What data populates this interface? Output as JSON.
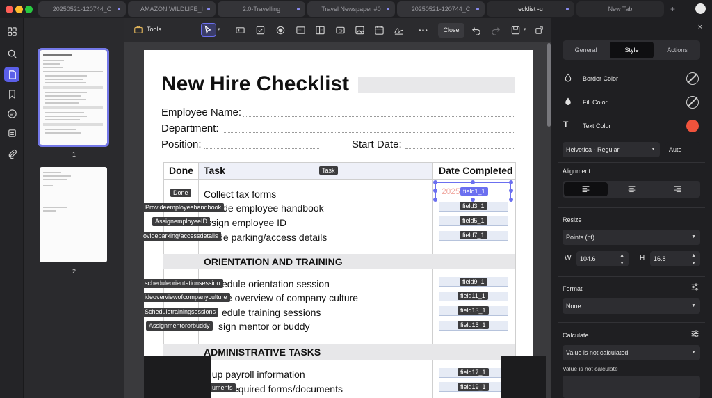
{
  "tabs": [
    {
      "label": "20250521-120744_C"
    },
    {
      "label": "AMAZON WILDLIFE_I"
    },
    {
      "label": "2.0-Travelling"
    },
    {
      "label": "Travel Newspaper #0"
    },
    {
      "label": "20250521-120744_C"
    },
    {
      "label": "ecklist -u"
    },
    {
      "label": "New Tab"
    }
  ],
  "toolbar": {
    "tools_label": "Tools",
    "close_label": "Close"
  },
  "thumbnails": [
    {
      "page": "1"
    },
    {
      "page": "2"
    }
  ],
  "document": {
    "title": "New Hire Checklist",
    "employee_name_label": "Employee Name:",
    "department_label": "Department:",
    "position_label": "Position:",
    "start_date_label": "Start Date:",
    "table": {
      "headers": [
        "Done",
        "Task",
        "Date Completed"
      ],
      "task_tag": "Task",
      "done_tag": "Done",
      "rows_group1": [
        "Collect tax forms",
        "vide employee handbook",
        "ssign employee ID",
        "ide parking/access details"
      ],
      "section2": "ORIENTATION AND TRAINING",
      "rows_group2": [
        "edule orientation session",
        "e overview of company culture",
        "edule training sessions",
        "sign mentor or buddy"
      ],
      "section3": "ADMINISTRATIVE TASKS",
      "rows_group3": [
        "t up payroll information",
        "ete required forms/documents"
      ]
    },
    "date_value_ghost": "2025",
    "fields_group1": [
      "field1_1",
      "field3_1",
      "field5_1",
      "field7_1"
    ],
    "fields_group2": [
      "field9_1",
      "field11_1",
      "field13_1",
      "field15_1"
    ],
    "fields_group3": [
      "field17_1",
      "field19_1"
    ],
    "left_tags_group1": [
      "Provideemployeehandbook",
      "AssignemployeeID",
      "ovideparking/accessdetails"
    ],
    "left_tags_group2": [
      "scheduleorientationsession",
      "ideoverviewofcompanyculture",
      "Scheduletrainingsessions",
      "Assignmentororbuddy"
    ],
    "left_tags_group3": [
      "uments"
    ]
  },
  "panel": {
    "tabs": [
      "General",
      "Style",
      "Actions"
    ],
    "active_tab": "Style",
    "border_color_label": "Border Color",
    "fill_color_label": "Fill Color",
    "text_color_label": "Text Color",
    "text_color": "#f0533c",
    "font": "Helvetica - Regular",
    "font_size": "Auto",
    "alignment_label": "Alignment",
    "resize_label": "Resize",
    "units": "Points (pt)",
    "w_label": "W",
    "w_value": "104.6",
    "h_label": "H",
    "h_value": "16.8",
    "format_label": "Format",
    "format_value": "None",
    "calculate_label": "Calculate",
    "calculate_value": "Value is not calculated",
    "calculate_note": "Value is not calculate"
  },
  "colors": {
    "accent": "#5b5fe8",
    "window_red": "#ff5f57",
    "window_yellow": "#febc2e",
    "window_green": "#28c840"
  }
}
